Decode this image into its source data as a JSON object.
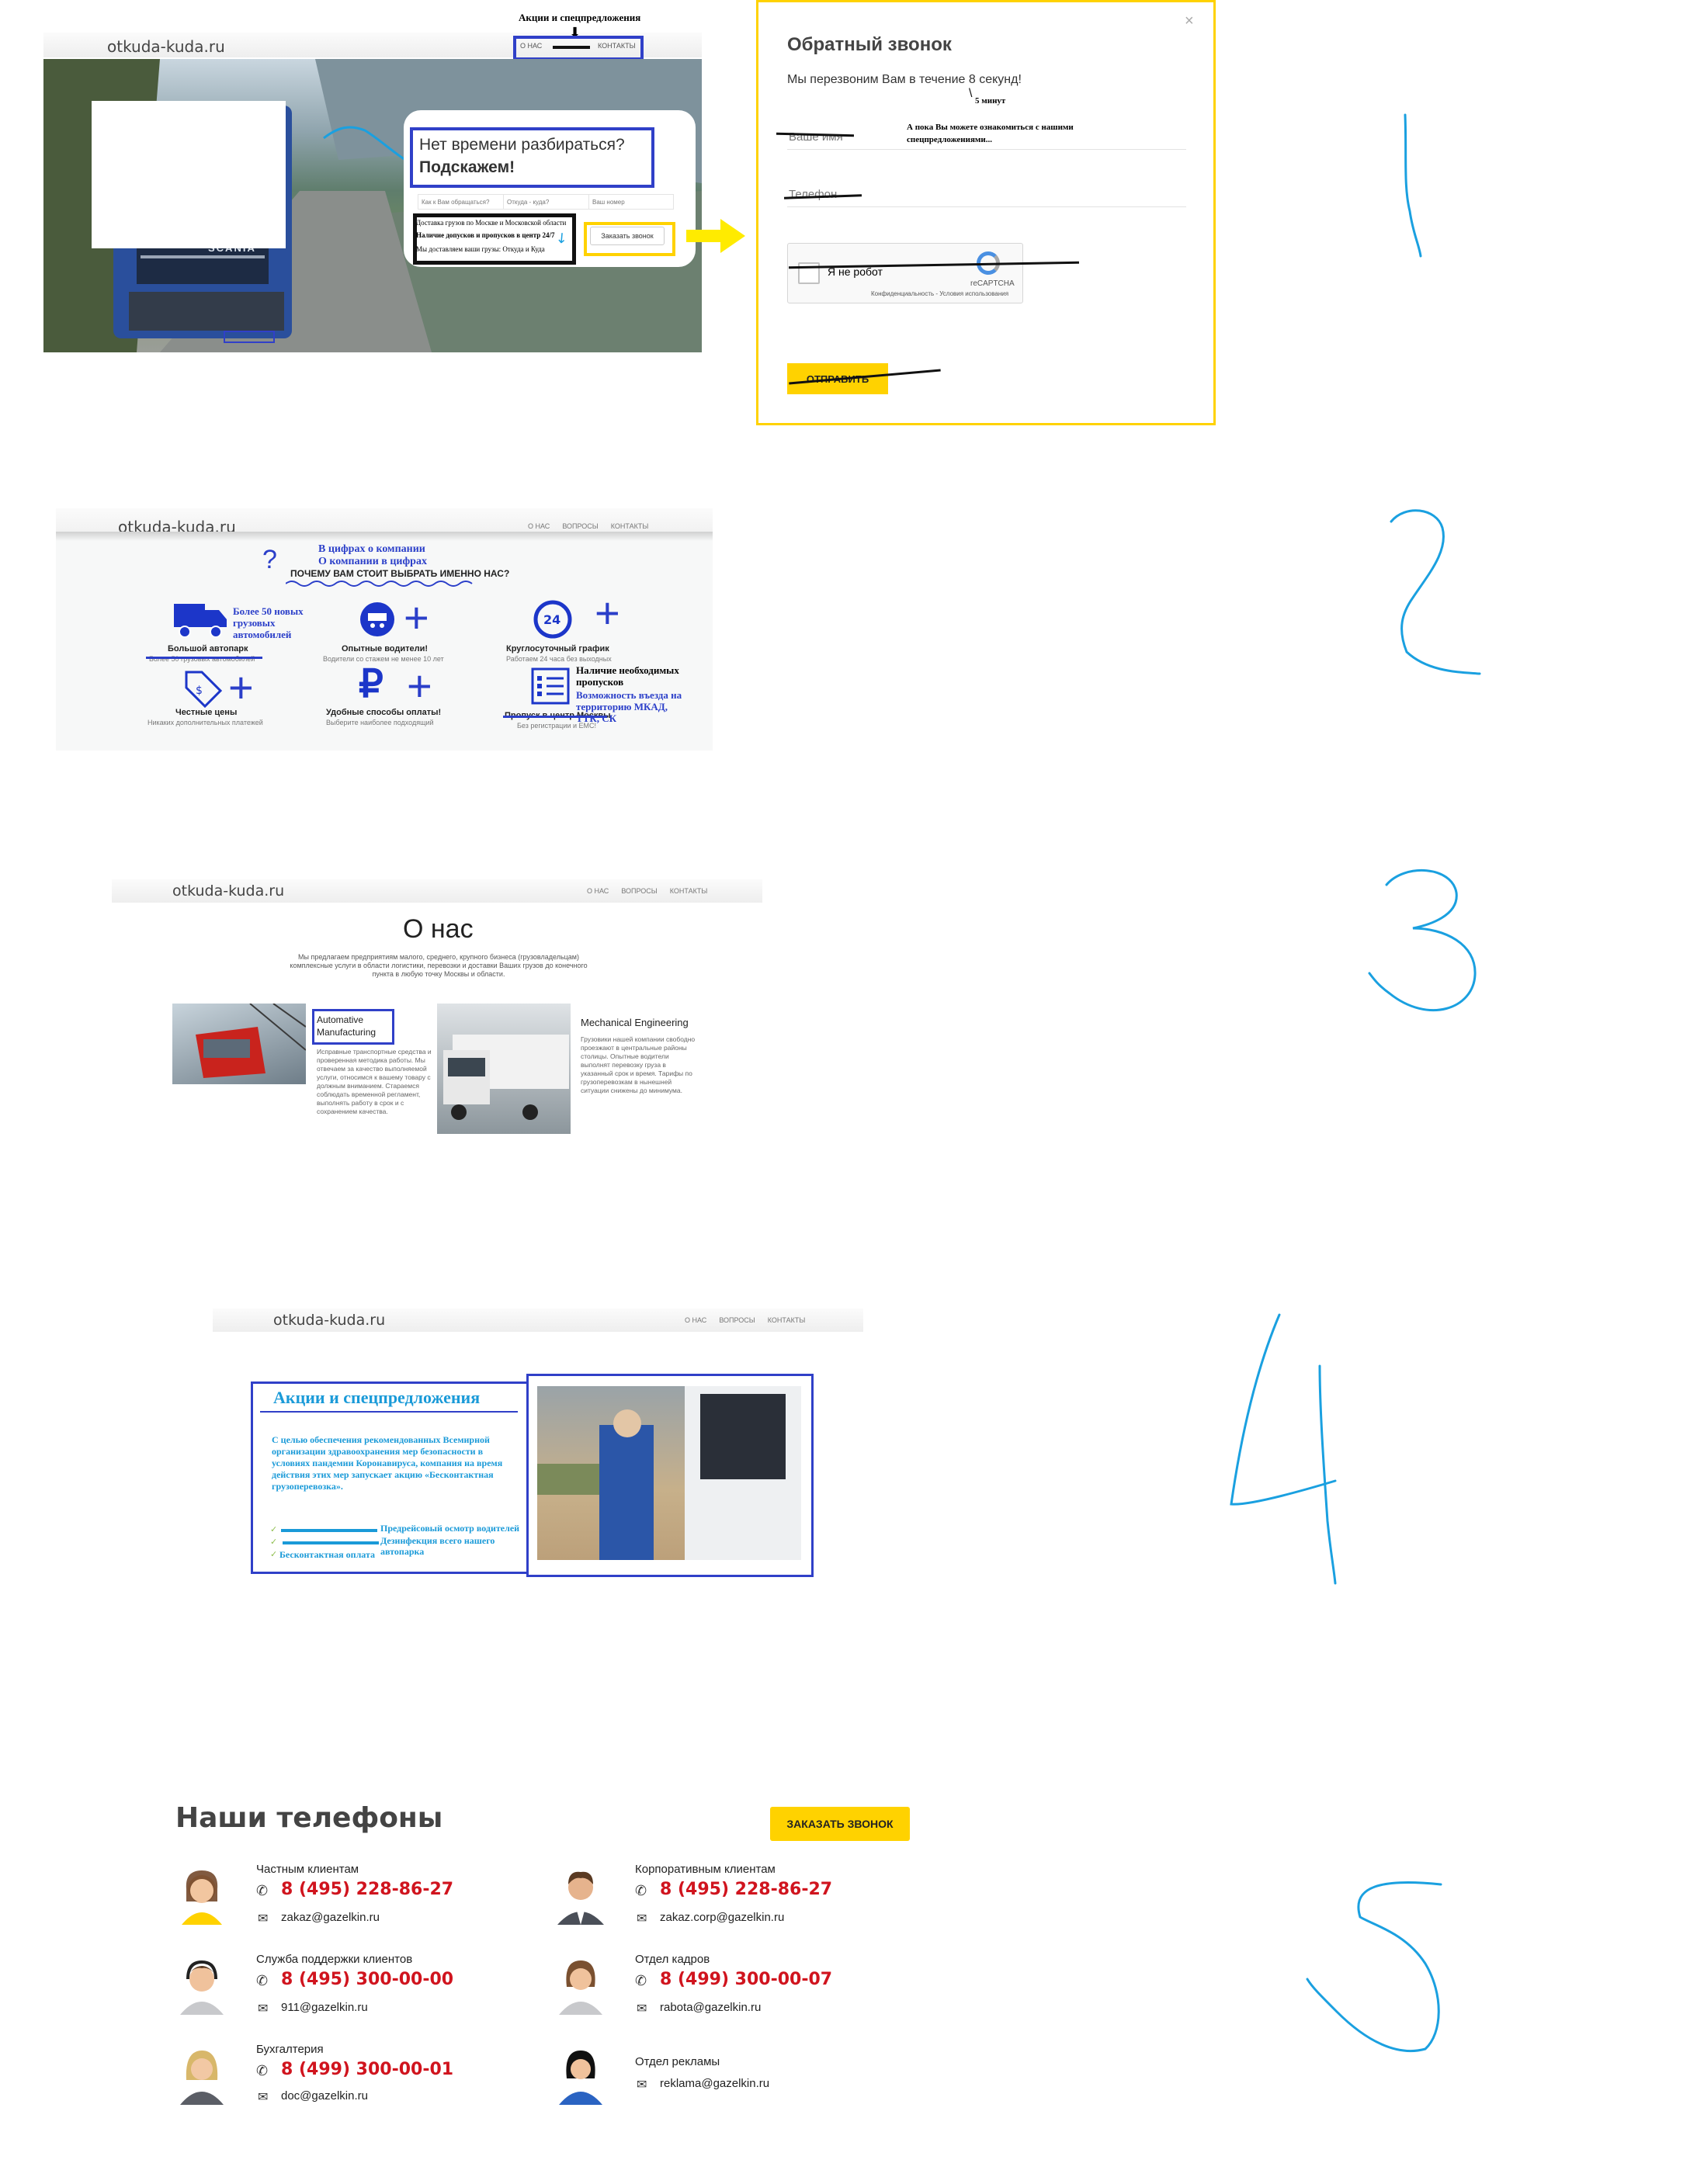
{
  "site": {
    "logo": "otkuda-kuda.ru"
  },
  "section1": {
    "nav": {
      "about": "О НАС",
      "contacts": "КОНТАКТЫ"
    },
    "annotation_promo": "Акции и спецпредложения",
    "hero_title_line1": "Нет времени разбираться?",
    "hero_title_line2": "Подскажем!",
    "input_name_placeholder": "Как к Вам обращаться?",
    "input_route_placeholder": "Откуда - куда?",
    "input_phone_placeholder": "Ваш номер",
    "note_line1": "Доставка грузов по Москве и Московской области",
    "note_line2": "Наличие допусков и пропусков в центр 24/7",
    "note_line3": "Мы доставляем ваши грузы: Откуда и Куда",
    "order_button": "Заказать звонок",
    "truck_brand": "SCANIA"
  },
  "modal": {
    "title": "Обратный звонок",
    "subtitle": "Мы перезвоним Вам в течение 8 секунд!",
    "annotation_minutes": "5 минут",
    "annotation_offer": "А пока Вы можете ознакомиться с нашими спецпредложениями...",
    "name_placeholder": "Ваше имя",
    "phone_placeholder": "Телефон",
    "captcha_label": "Я не робот",
    "captcha_brand": "reCAPTCHA",
    "captcha_links": "Конфиденциальность - Условия использования",
    "submit": "ОТПРАВИТЬ"
  },
  "section2": {
    "nav": [
      "О НАС",
      "ВОПРОСЫ",
      "КОНТАКТЫ"
    ],
    "annotation_line1": "В цифрах о компании",
    "annotation_line2": "О компании в цифрах",
    "heading": "ПОЧЕМУ ВАМ СТОИТ ВЫБРАТЬ ИМЕННО НАС?",
    "features": [
      {
        "annotation": "Более 50 новых грузовых автомобилей",
        "title": "Большой автопарк",
        "sub": "Более 50 грузовых автомобилей"
      },
      {
        "title": "Опытные водители!",
        "sub": "Водители со стажем не менее 10 лет"
      },
      {
        "title": "Круглосуточный график",
        "sub": "Работаем 24 часа без выходных"
      },
      {
        "title": "Честные цены",
        "sub": "Никаких дополнительных платежей"
      },
      {
        "title": "Удобные способы оплаты!",
        "sub": "Выберите наиболее подходящий"
      },
      {
        "annotation_title": "Наличие необходимых пропусков",
        "annotation_sub": "Возможность въезда на территорию МКАД, ТТК, СК",
        "title": "Пропуск в центр Москвы",
        "sub": "Без регистрации и ЕМС!"
      }
    ]
  },
  "section3": {
    "nav": [
      "О НАС",
      "ВОПРОСЫ",
      "КОНТАКТЫ"
    ],
    "title": "О нас",
    "intro": "Мы предлагаем предприятиям малого, среднего, крупного бизнеса (грузовладельцам) комплексные услуги в области логистики, перевозки и доставки Ваших грузов до конечного пункта в любую точку Москвы и области.",
    "card1_title": "Automative Manufacturing",
    "card1_text": "Исправные транспортные средства и проверенная методика работы. Мы отвечаем за качество выполняемой услуги, относимся к вашему товару с должным вниманием. Стараемся соблюдать временной регламент, выполнять работу в срок и с сохранением качества.",
    "card2_title": "Mechanical Engineering",
    "card2_text": "Грузовики нашей компании свободно проезжают в центральные районы столицы. Опытные водители выполнят перевозку груза в указанный срок и время. Тарифы по грузоперевозкам в нынешней ситуации снижены до минимума."
  },
  "section4": {
    "nav": [
      "О НАС",
      "ВОПРОСЫ",
      "КОНТАКТЫ"
    ],
    "title": "Акции и спецпредложения",
    "text": "С целью обеспечения рекомендованных Всемирной организации здравоохранения мер безопасности в условиях пандемии Коронавируса, компания на время действия этих мер запускает акцию «Бесконтактная грузоперевозка».",
    "items": [
      "Предрейсовый осмотр водителей",
      "Дезинфекция всего нашего автопарка",
      "Бесконтактная оплата"
    ]
  },
  "section5": {
    "title": "Наши телефоны",
    "order_button": "ЗАКАЗАТЬ ЗВОНОК",
    "contacts": [
      {
        "label": "Частным клиентам",
        "phone": "8 (495) 228-86-27",
        "email": "zakaz@gazelkin.ru"
      },
      {
        "label": "Корпоративным клиентам",
        "phone": "8 (495) 228-86-27",
        "email": "zakaz.corp@gazelkin.ru"
      },
      {
        "label": "Служба поддержки клиентов",
        "phone": "8 (495) 300-00-00",
        "email": "911@gazelkin.ru"
      },
      {
        "label": "Отдел кадров",
        "phone": "8 (499) 300-00-07",
        "email": "rabota@gazelkin.ru"
      },
      {
        "label": "Бухгалтерия",
        "phone": "8 (499) 300-00-01",
        "email": "doc@gazelkin.ru"
      },
      {
        "label": "Отдел рекламы",
        "phone": "",
        "email": "reklama@gazelkin.ru"
      }
    ]
  },
  "markers": [
    "1",
    "2",
    "3",
    "4",
    "5"
  ],
  "colors": {
    "accent_yellow": "#ffd200",
    "annotation_blue": "#3040c8",
    "phone_red": "#d0141e",
    "marker_cyan": "#1aa0e0"
  }
}
